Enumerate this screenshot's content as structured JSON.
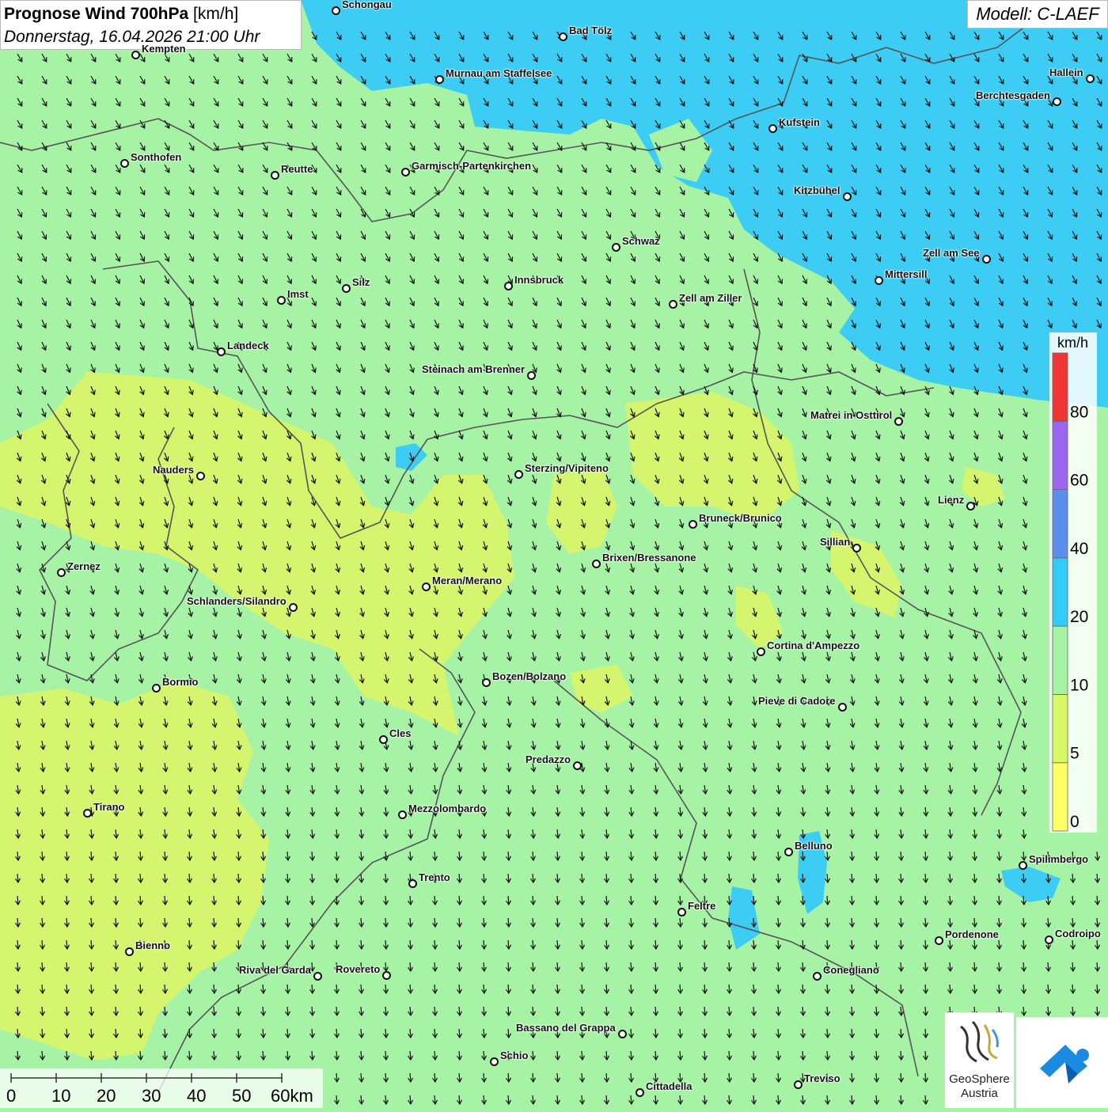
{
  "title": {
    "main": "Prognose Wind 700hPa",
    "unit": " [km/h]",
    "datetime": "Donnerstag, 16.04.2026 21:00 Uhr"
  },
  "model": "Modell: C-LAEF",
  "legend": {
    "unit": "km/h",
    "classes": [
      {
        "label": "0",
        "color": "#ffff66"
      },
      {
        "label": "5",
        "color": "#d9f866"
      },
      {
        "label": "10",
        "color": "#a6f3a6"
      },
      {
        "label": "20",
        "color": "#33ccf6"
      },
      {
        "label": "40",
        "color": "#5a8ff0"
      },
      {
        "label": "60",
        "color": "#9a66f0"
      },
      {
        "label": "80",
        "color": "#f03535"
      }
    ]
  },
  "scalebar": {
    "ticks": [
      "0",
      "10",
      "20",
      "30",
      "40",
      "50",
      "60km"
    ]
  },
  "logos": {
    "geosphere": "GeoSphere\nAustria",
    "geosphere_icon": "geosphere-logo-icon",
    "app_icon": "wetter-app-icon"
  },
  "cities": [
    {
      "name": "Schongau"
    },
    {
      "name": "Bad Tölz"
    },
    {
      "name": "Kempten"
    },
    {
      "name": "Murnau am Staffelsee"
    },
    {
      "name": "Hallein"
    },
    {
      "name": "Berchtesgaden"
    },
    {
      "name": "Kufstein"
    },
    {
      "name": "Sonthofen"
    },
    {
      "name": "Reutte"
    },
    {
      "name": "Garmisch-Partenkirchen"
    },
    {
      "name": "Kitzbühel"
    },
    {
      "name": "Schwaz"
    },
    {
      "name": "Zell am See"
    },
    {
      "name": "Innsbruck"
    },
    {
      "name": "Mittersill"
    },
    {
      "name": "Silz"
    },
    {
      "name": "Imst"
    },
    {
      "name": "Zell am Ziller"
    },
    {
      "name": "Landeck"
    },
    {
      "name": "Steinach am Brenner"
    },
    {
      "name": "Matrei in Osttirol"
    },
    {
      "name": "Nauders"
    },
    {
      "name": "Sterzing/Vipiteno"
    },
    {
      "name": "Lienz"
    },
    {
      "name": "Bruneck/Brunico"
    },
    {
      "name": "Sillian"
    },
    {
      "name": "Zernez"
    },
    {
      "name": "Brixen/Bressanone"
    },
    {
      "name": "Meran/Merano"
    },
    {
      "name": "Schlanders/Silandro"
    },
    {
      "name": "Cortina d'Ampezzo"
    },
    {
      "name": "Bozen/Bolzano"
    },
    {
      "name": "Bormio"
    },
    {
      "name": "Pieve di Cadore"
    },
    {
      "name": "Cles"
    },
    {
      "name": "Predazzo"
    },
    {
      "name": "Tirano"
    },
    {
      "name": "Mezzolombardo"
    },
    {
      "name": "Belluno"
    },
    {
      "name": "Spilimbergo"
    },
    {
      "name": "Trento"
    },
    {
      "name": "Feltre"
    },
    {
      "name": "Pordenone"
    },
    {
      "name": "Codroipo"
    },
    {
      "name": "Bienno"
    },
    {
      "name": "Riva del Garda"
    },
    {
      "name": "Rovereto"
    },
    {
      "name": "Conegliano"
    },
    {
      "name": "Bassano del Grappa"
    },
    {
      "name": "Schio"
    },
    {
      "name": "Treviso"
    },
    {
      "name": "Cittadella"
    }
  ]
}
